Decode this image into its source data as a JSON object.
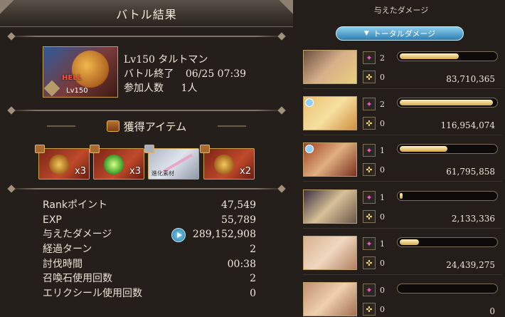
{
  "header": {
    "title": "バトル結果"
  },
  "boss": {
    "badge": "HELL",
    "level_badge": "Lv150",
    "name_line": "Lv150 タルトマン"
  },
  "battle_info": [
    {
      "label": "バトル終了",
      "value": "06/25 07:39"
    },
    {
      "label": "参加人数",
      "value": "1人"
    }
  ],
  "items_section": {
    "title": "獲得アイテム"
  },
  "items": [
    {
      "name": "gold-medal",
      "qty": "x3"
    },
    {
      "name": "green-orb",
      "qty": "x3"
    },
    {
      "name": "evolution-material",
      "qty": "",
      "tag": "進化素材"
    },
    {
      "name": "gold-medal",
      "qty": "x2"
    }
  ],
  "stats": [
    {
      "label": "Rankポイント",
      "value": "47,549"
    },
    {
      "label": "EXP",
      "value": "55,789"
    },
    {
      "label": "与えたダメージ",
      "value": "289,152,908"
    },
    {
      "label": "経過ターン",
      "value": "2"
    },
    {
      "label": "討伐時間",
      "value": "00:38"
    },
    {
      "label": "召喚石使用回数",
      "value": "2"
    },
    {
      "label": "エリクシール使用回数",
      "value": "0"
    }
  ],
  "damage_panel": {
    "title": "与えたダメージ",
    "toggle_label": "トータルダメージ",
    "members": [
      {
        "skills": "2",
        "summons": "0",
        "damage": "83,710,365",
        "bar_fraction": 0.62
      },
      {
        "skills": "2",
        "summons": "0",
        "damage": "116,954,074",
        "bar_fraction": 0.98
      },
      {
        "skills": "1",
        "summons": "0",
        "damage": "61,795,858",
        "bar_fraction": 0.5
      },
      {
        "skills": "1",
        "summons": "0",
        "damage": "2,133,336",
        "bar_fraction": 0.02
      },
      {
        "skills": "1",
        "summons": "0",
        "damage": "24,439,275",
        "bar_fraction": 0.2
      },
      {
        "skills": "0",
        "summons": "0",
        "damage": "0",
        "bar_fraction": 0.0
      }
    ]
  },
  "colors": {
    "accent_blue": "#2f7eb0",
    "bar_gold": "#d8a848",
    "frame_gold": "#c9a04f"
  }
}
